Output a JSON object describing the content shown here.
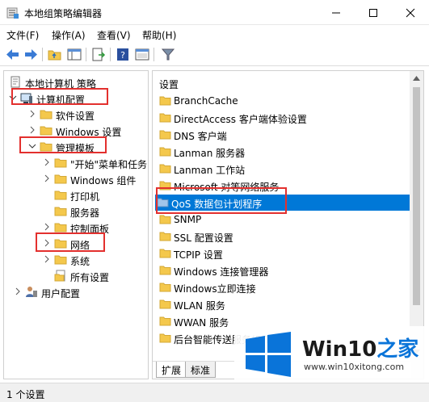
{
  "window": {
    "title": "本地组策略编辑器"
  },
  "menu": [
    {
      "label": "文件(F)"
    },
    {
      "label": "操作(A)"
    },
    {
      "label": "查看(V)"
    },
    {
      "label": "帮助(H)"
    }
  ],
  "toolbar": {
    "buttons": [
      "back-arrow-icon",
      "forward-arrow-icon",
      "up-folder-icon",
      "show-tree-icon",
      "export-list-icon",
      "help-icon",
      "console-icon",
      "filter-icon"
    ]
  },
  "tree": {
    "root": "本地计算机 策略",
    "computer_config": "计算机配置",
    "software_settings": "软件设置",
    "windows_settings": "Windows 设置",
    "admin_templates": "管理模板",
    "start_menu": "\"开始\"菜单和任务",
    "windows_components": "Windows 组件",
    "printers": "打印机",
    "servers": "服务器",
    "control_panel": "控制面板",
    "network": "网络",
    "system": "系统",
    "all_settings": "所有设置",
    "user_config": "用户配置"
  },
  "list": {
    "header": "设置",
    "items": [
      "BranchCache",
      "DirectAccess 客户端体验设置",
      "DNS 客户端",
      "Lanman 服务器",
      "Lanman 工作站",
      "Microsoft 对等网络服务",
      "QoS 数据包计划程序",
      "SNMP",
      "SSL 配置设置",
      "TCPIP 设置",
      "Windows 连接管理器",
      "Windows立即连接",
      "WLAN 服务",
      "WWAN 服务",
      "后台智能传送服务(BITS)"
    ],
    "selected_index": 6
  },
  "tabs": {
    "expand": "扩展",
    "standard": "标准"
  },
  "status": {
    "text": "1 个设置"
  },
  "watermark": {
    "title_main": "Win10",
    "title_accent": "之家",
    "url": "www.win10xitong.com"
  },
  "colors": {
    "selection": "#0078d7",
    "highlight_box": "#e3302e",
    "folder": "#f4c84c"
  }
}
